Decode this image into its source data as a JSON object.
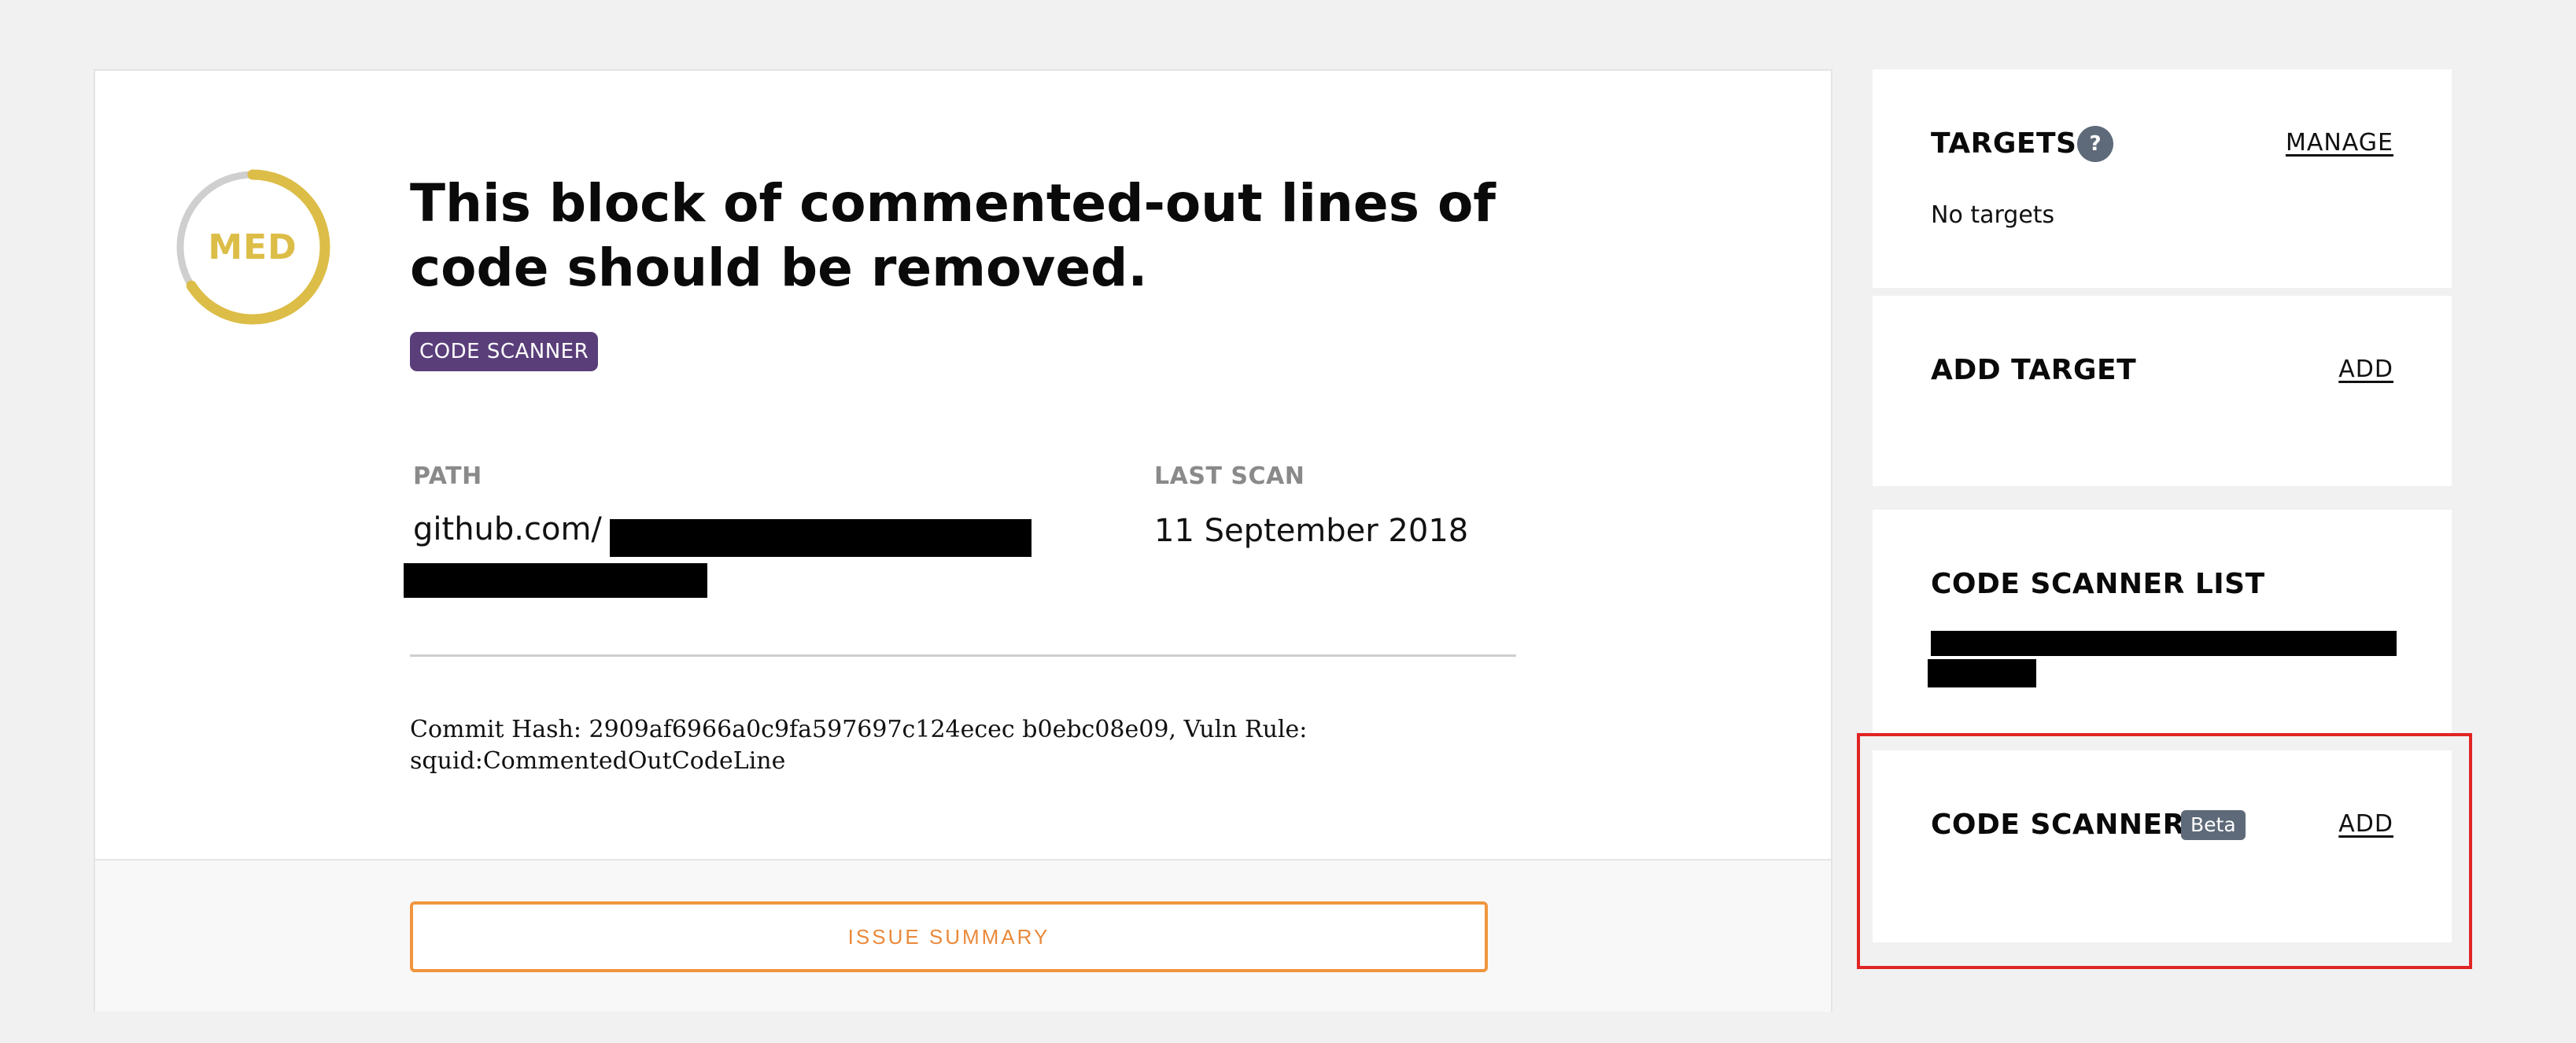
{
  "issue": {
    "severity": "MED",
    "severity_level": 0.66,
    "severity_color": "#dcbd47",
    "title": "This block of commented-out lines of code should be removed.",
    "source_badge": "CODE SCANNER",
    "path_label": "PATH",
    "path_value": "github.com/",
    "last_scan_label": "LAST SCAN",
    "last_scan_value": "11 September 2018",
    "details": "Commit Hash: 2909af6966a0c9fa597697c124ecec b0ebc08e09, Vuln Rule: squid:CommentedOutCodeLine",
    "summary_button": "ISSUE SUMMARY"
  },
  "sidebar": {
    "targets": {
      "heading": "TARGETS",
      "help_icon": "?",
      "link": "MANAGE",
      "empty_text": "No targets"
    },
    "add_target": {
      "heading": "ADD TARGET",
      "link": "ADD"
    },
    "scanner_list": {
      "heading": "CODE SCANNER LIST"
    },
    "code_scanner": {
      "heading": "CODE SCANNER",
      "badge": "Beta",
      "link": "ADD"
    }
  },
  "colors": {
    "badge_purple": "#5a3e7a",
    "button_orange": "#f0953e",
    "highlight_red": "#e02424"
  }
}
